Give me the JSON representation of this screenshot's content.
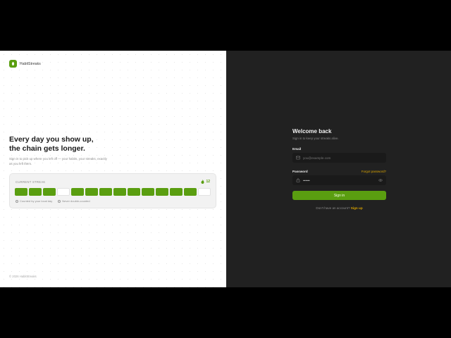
{
  "brand": {
    "name": "HabitStreaks"
  },
  "hero": {
    "headline_line1": "Every day you show up,",
    "headline_line2": "the chain gets longer.",
    "subtext": "Sign in to pick up where you left off — your habits, your streaks, exactly as you left them."
  },
  "streak": {
    "label": "CURRENT STREAK",
    "count": "12",
    "days": [
      true,
      true,
      true,
      false,
      true,
      true,
      true,
      true,
      true,
      true,
      true,
      true,
      true,
      false
    ],
    "note1": "Counted by your local day",
    "note2": "Never double-counted"
  },
  "footer": {
    "copyright": "© 2026 HabitStreaks"
  },
  "login": {
    "title": "Welcome back",
    "subtitle": "Sign in to keep your streaks alive.",
    "email_label": "Email",
    "email_placeholder": "you@example.com",
    "password_label": "Password",
    "password_value": "••••••",
    "forgot": "Forgot password?",
    "submit": "Sign in",
    "no_account": "Don't have an account?",
    "signup": "Sign up"
  },
  "colors": {
    "accent": "#5a9e10",
    "link": "#d9a300",
    "dark_bg": "#212121"
  },
  "icons": [
    "leaf-logo-icon",
    "flame-icon",
    "clock-icon",
    "shield-icon",
    "mail-icon",
    "lock-icon",
    "eye-icon"
  ]
}
